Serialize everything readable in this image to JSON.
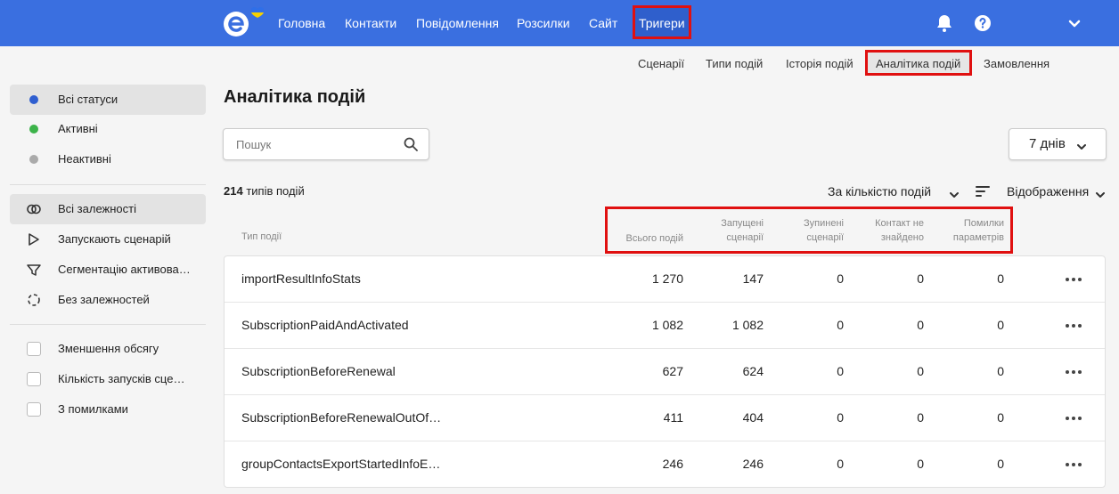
{
  "nav": {
    "items": [
      "Головна",
      "Контакти",
      "Повідомлення",
      "Розсилки",
      "Сайт",
      "Тригери"
    ],
    "active": "Тригери",
    "icons": [
      "bell-icon",
      "help-icon",
      "chevron-down-icon"
    ]
  },
  "subtabs": {
    "items": [
      "Сценарії",
      "Типи подій",
      "Історія подій",
      "Аналітика подій",
      "Замовлення"
    ],
    "active": "Аналітика подій"
  },
  "sidebar": {
    "statuses": [
      {
        "label": "Всі статуси",
        "color": "#2f5fd0"
      },
      {
        "label": "Активні",
        "color": "#3cb34a"
      },
      {
        "label": "Неактивні",
        "color": "#aaaaaa"
      }
    ],
    "dependencies": [
      {
        "label": "Всі залежності",
        "icon": "link-icon"
      },
      {
        "label": "Запускають сценарій",
        "icon": "play-icon"
      },
      {
        "label": "Сегментацію активова…",
        "icon": "filter-icon"
      },
      {
        "label": "Без залежностей",
        "icon": "unlink-icon"
      }
    ],
    "filters": [
      "Зменшення обсягу",
      "Кількість запусків сце…",
      "З помилками"
    ]
  },
  "main": {
    "title": "Аналітика подій",
    "search_placeholder": "Пошук",
    "period": "7 днів",
    "count_number": "214",
    "count_text": "типів подій",
    "sort_label": "За кількістю подій",
    "view_label": "Відображення"
  },
  "table": {
    "col_type": "Тип події",
    "col_total": "Всього подій",
    "col_launched_1": "Запущені",
    "col_launched_2": "сценарії",
    "col_stopped_1": "Зупинені",
    "col_stopped_2": "сценарії",
    "col_notfound_1": "Контакт не",
    "col_notfound_2": "знайдено",
    "col_errors_1": "Помилки",
    "col_errors_2": "параметрів",
    "rows": [
      {
        "name": "importResultInfoStats",
        "total": "1 270",
        "launched": "147",
        "stopped": "0",
        "notfound": "0",
        "errors": "0"
      },
      {
        "name": "SubscriptionPaidAndActivated",
        "total": "1 082",
        "launched": "1 082",
        "stopped": "0",
        "notfound": "0",
        "errors": "0"
      },
      {
        "name": "SubscriptionBeforeRenewal",
        "total": "627",
        "launched": "624",
        "stopped": "0",
        "notfound": "0",
        "errors": "0"
      },
      {
        "name": "SubscriptionBeforeRenewalOutOf…",
        "total": "411",
        "launched": "404",
        "stopped": "0",
        "notfound": "0",
        "errors": "0"
      },
      {
        "name": "groupContactsExportStartedInfoE…",
        "total": "246",
        "launched": "246",
        "stopped": "0",
        "notfound": "0",
        "errors": "0"
      }
    ]
  },
  "colors": {
    "primary": "#3a6fe0",
    "highlight": "#e01010",
    "active_bg": "#e3e3e3"
  }
}
